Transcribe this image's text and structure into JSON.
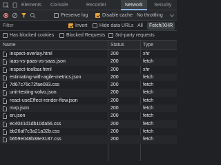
{
  "tabs": {
    "console": "Console",
    "elements": "Elements",
    "recorder": "Recorder",
    "network": "Network",
    "security": "Security"
  },
  "toolbar": {
    "preserve_log": "Preserve log",
    "disable_cache": "Disable cache",
    "throttling": "No throttling"
  },
  "filter": {
    "placeholder": "Filter",
    "invert": "Invert",
    "hide_data_urls": "Hide data URLs",
    "all": "All",
    "fetch_xhr": "Fetch/XHR"
  },
  "options": {
    "blocked_cookies": "Has blocked cookies",
    "blocked_requests": "Blocked Requests",
    "third_party": "3rd-party requests"
  },
  "columns": {
    "name": "Name",
    "status": "Status",
    "type": "Type"
  },
  "requests": [
    {
      "name": "inspect-overlay.html",
      "status": "200",
      "type": "xhr"
    },
    {
      "name": "iaas-vs-paas-vs-saas.json",
      "status": "200",
      "type": "fetch"
    },
    {
      "name": "inspect-toolbar.html",
      "status": "200",
      "type": "xhr"
    },
    {
      "name": "estimating-with-agile-metrics.json",
      "status": "200",
      "type": "fetch"
    },
    {
      "name": "7d67c76c72fae093.css",
      "status": "200",
      "type": "fetch"
    },
    {
      "name": "unit-testing-volvo.json",
      "status": "200",
      "type": "fetch"
    },
    {
      "name": "react-useEffect-render-flow.json",
      "status": "200",
      "type": "fetch"
    },
    {
      "name": "mvp.json",
      "status": "200",
      "type": "fetch"
    },
    {
      "name": "en.json",
      "status": "200",
      "type": "fetch"
    },
    {
      "name": "ec4041d1db10da56.css",
      "status": "200",
      "type": "fetch"
    },
    {
      "name": "bb26af7c3a21a32b.css",
      "status": "200",
      "type": "fetch"
    },
    {
      "name": "b659e048b38e3187.css",
      "status": "200",
      "type": "fetch"
    }
  ],
  "colors": {
    "accent": "#8ab4f8",
    "checkbox": "#e8a33d",
    "record": "#f28b82"
  }
}
